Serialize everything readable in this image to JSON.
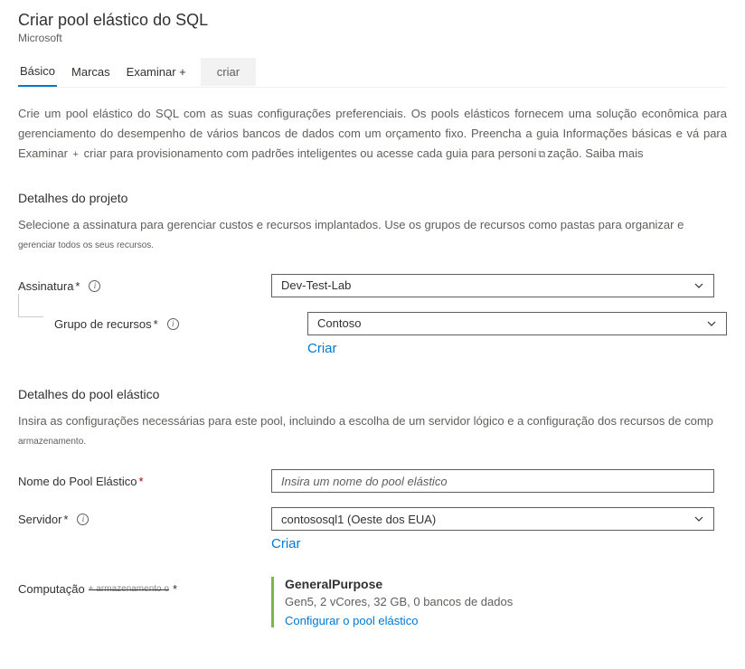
{
  "header": {
    "title": "Criar pool elástico do SQL",
    "subtitle": "Microsoft"
  },
  "tabs": {
    "basic": "Básico",
    "tags": "Marcas",
    "review": "Examinar +",
    "create": "criar"
  },
  "intro": {
    "line1": "Crie um pool elástico do SQL com as suas configurações preferenciais. Os pools elásticos fornecem uma solução econômica para gerenciamento do desempenho de vários bancos de dados com um orçamento fixo. Preencha a guia Informações básicas e vá para Examinar",
    "line2_before": "criar para provisionamento com padrões inteligentes ou acesse cada guia para perso",
    "line2_after": "zação. Saiba mais"
  },
  "project": {
    "heading": "Detalhes do projeto",
    "desc_main": "Selecione a assinatura para gerenciar custos e recursos implantados. Use os grupos de recursos como pastas para organizar e ",
    "desc_sub": "gerenciar todos os seus recursos.",
    "subscription_label": "Assinatura",
    "subscription_value": "Dev-Test-Lab",
    "resource_group_label": "Grupo de recursos",
    "resource_group_value": "Contoso",
    "create_link": "Criar"
  },
  "pool": {
    "heading": "Detalhes do pool elástico",
    "desc_main": "Insira as configurações necessárias para este pool, incluindo a escolha de um servidor lógico e a configuração dos recursos de comp",
    "desc_sub": "armazenamento.",
    "name_label": "Nome do Pool Elástic",
    "name_placeholder": "Insira um nome do pool elástico",
    "server_label": "Servidor",
    "server_value": "contososql1 (Oeste dos EUA)",
    "create_link": "Criar"
  },
  "compute": {
    "label_main": "Computação",
    "label_sub": "armazenamento",
    "title": "GeneralPurpose",
    "detail": "Gen5, 2 vCores, 32 GB, 0 bancos de dados",
    "link": "Configurar o pool elástico"
  },
  "glyphs": {
    "plus": "+",
    "required": "*",
    "info": "i",
    "ni_fragment": "ni",
    "o_fragment": "o"
  }
}
